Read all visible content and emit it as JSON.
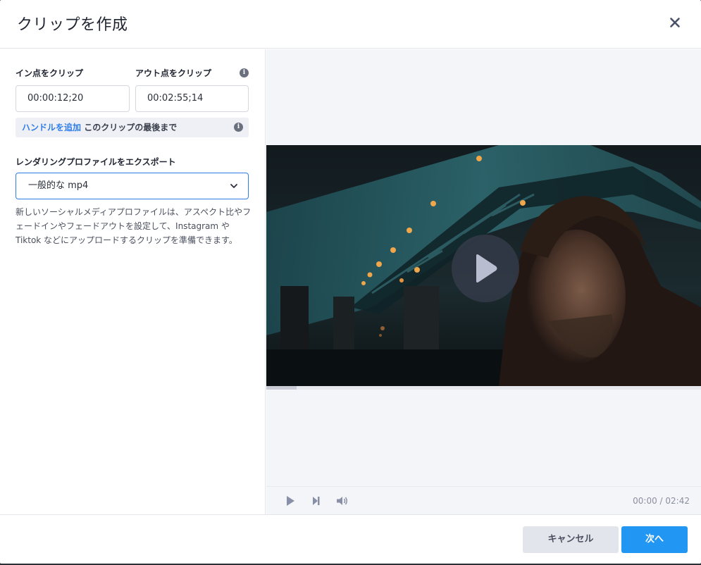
{
  "dialog": {
    "title": "クリップを作成",
    "close_icon": "close-icon"
  },
  "clip": {
    "in_label": "イン点をクリップ",
    "out_label": "アウト点をクリップ",
    "in_value": "00:00:12;20",
    "out_value": "00:02:55;14",
    "handle_link": "ハンドルを追加",
    "handle_text": " このクリップの最後まで",
    "info_icon": "info-icon"
  },
  "export": {
    "label": "レンダリングプロファイルをエクスポート",
    "selected": "一般的な mp4",
    "description": "新しいソーシャルメディアプロファイルは、アスペクト比やフェードインやフェードアウトを設定して、Instagram や Tiktok などにアップロードするクリップを準備できます。"
  },
  "player": {
    "time_display": "00:00 / 02:42",
    "progress_fraction": 0.07,
    "play_icon": "play-icon",
    "step_icon": "step-forward-icon",
    "volume_icon": "volume-icon"
  },
  "footer": {
    "cancel_label": "キャンセル",
    "next_label": "次へ"
  },
  "colors": {
    "accent": "#2e7de9",
    "primary_button": "#2196f3",
    "cancel_button": "#e3e5ec"
  }
}
